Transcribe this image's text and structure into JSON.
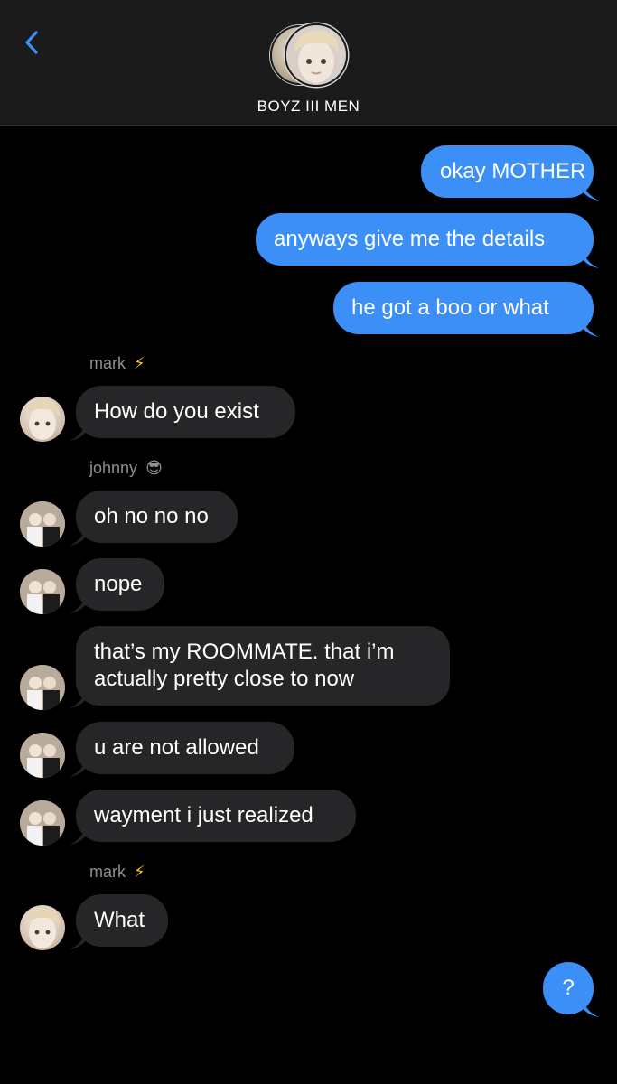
{
  "header": {
    "title": "BOYZ III MEN",
    "back_icon": "chevron-left-icon",
    "accent": "#3b8ff7"
  },
  "messages": [
    {
      "side": "out",
      "text": "okay MOTHER"
    },
    {
      "side": "out",
      "text": "anyways give me the details"
    },
    {
      "side": "out",
      "text": "he got a boo or what"
    },
    {
      "side": "label",
      "sender": "mark",
      "emoji": "⚡"
    },
    {
      "side": "in",
      "from": "mark",
      "text": "How do you exist"
    },
    {
      "side": "label",
      "sender": "johnny",
      "emoji": "😎"
    },
    {
      "side": "in",
      "from": "johnny",
      "text": "oh no no no"
    },
    {
      "side": "in",
      "from": "johnny",
      "text": "nope"
    },
    {
      "side": "in",
      "from": "johnny",
      "lines": [
        "that’s my ROOMMATE. that i’m",
        "actually pretty close to now"
      ]
    },
    {
      "side": "in",
      "from": "johnny",
      "text": "u are not allowed"
    },
    {
      "side": "in",
      "from": "johnny",
      "text": "wayment i just realized"
    },
    {
      "side": "label",
      "sender": "mark",
      "emoji": "⚡"
    },
    {
      "side": "in",
      "from": "mark",
      "text": "What"
    },
    {
      "side": "out",
      "text": "?"
    }
  ],
  "colors": {
    "outgoing_bubble": "#3b8ff7",
    "incoming_bubble": "#262628",
    "background": "#000000",
    "sender_label": "#8e8e93"
  }
}
